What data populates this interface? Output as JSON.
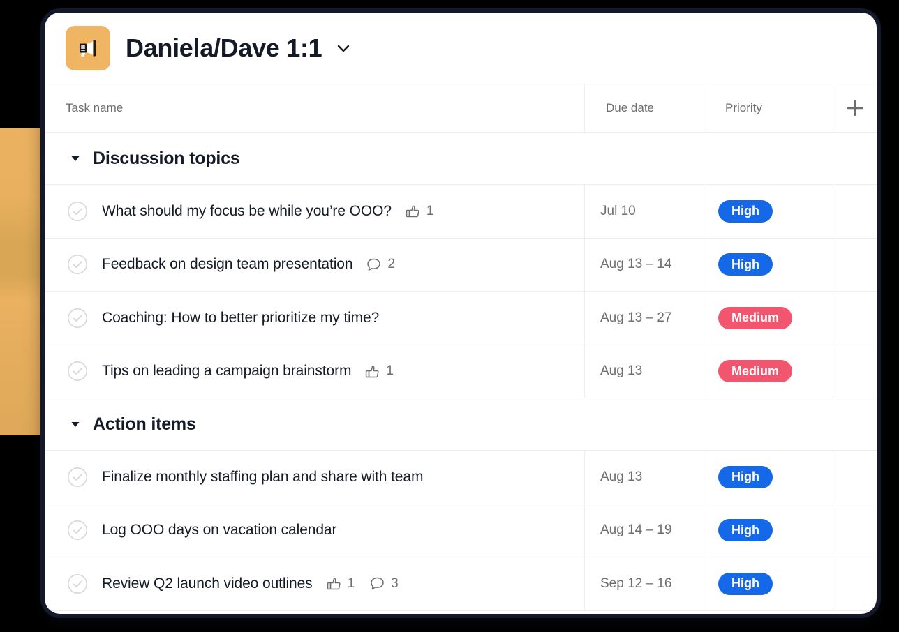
{
  "header": {
    "project_icon": "megaphone-icon",
    "project_icon_color": "#EFB563",
    "title": "Daniela/Dave 1:1",
    "caret": "chevron-down-icon"
  },
  "table": {
    "columns": [
      {
        "key": "task",
        "label": "Task name"
      },
      {
        "key": "due",
        "label": "Due date"
      },
      {
        "key": "priority",
        "label": "Priority"
      }
    ],
    "add_column_icon": "plus-icon"
  },
  "priority_colors": {
    "High": "#1569E8",
    "Medium": "#F2556E"
  },
  "sections": [
    {
      "title": "Discussion topics",
      "caret": "caret-down-icon",
      "tasks": [
        {
          "name": "What should my focus be while you’re OOO?",
          "like_count": "1",
          "comment_count": "",
          "due": "Jul 10",
          "priority": "High"
        },
        {
          "name": "Feedback on design team presentation",
          "like_count": "",
          "comment_count": "2",
          "due": "Aug 13 – 14",
          "priority": "High"
        },
        {
          "name": "Coaching: How to better prioritize my time?",
          "like_count": "",
          "comment_count": "",
          "due": "Aug 13 – 27",
          "priority": "Medium"
        },
        {
          "name": "Tips on leading a campaign brainstorm",
          "like_count": "1",
          "comment_count": "",
          "due": "Aug 13",
          "priority": "Medium"
        }
      ]
    },
    {
      "title": "Action items",
      "caret": "caret-down-icon",
      "tasks": [
        {
          "name": "Finalize monthly staffing plan and share with team",
          "like_count": "",
          "comment_count": "",
          "due": "Aug 13",
          "priority": "High"
        },
        {
          "name": "Log OOO days on vacation calendar",
          "like_count": "",
          "comment_count": "",
          "due": "Aug 14 – 19",
          "priority": "High"
        },
        {
          "name": "Review Q2 launch video outlines",
          "like_count": "1",
          "comment_count": "3",
          "due": "Sep 12 – 16",
          "priority": "High"
        }
      ]
    }
  ]
}
